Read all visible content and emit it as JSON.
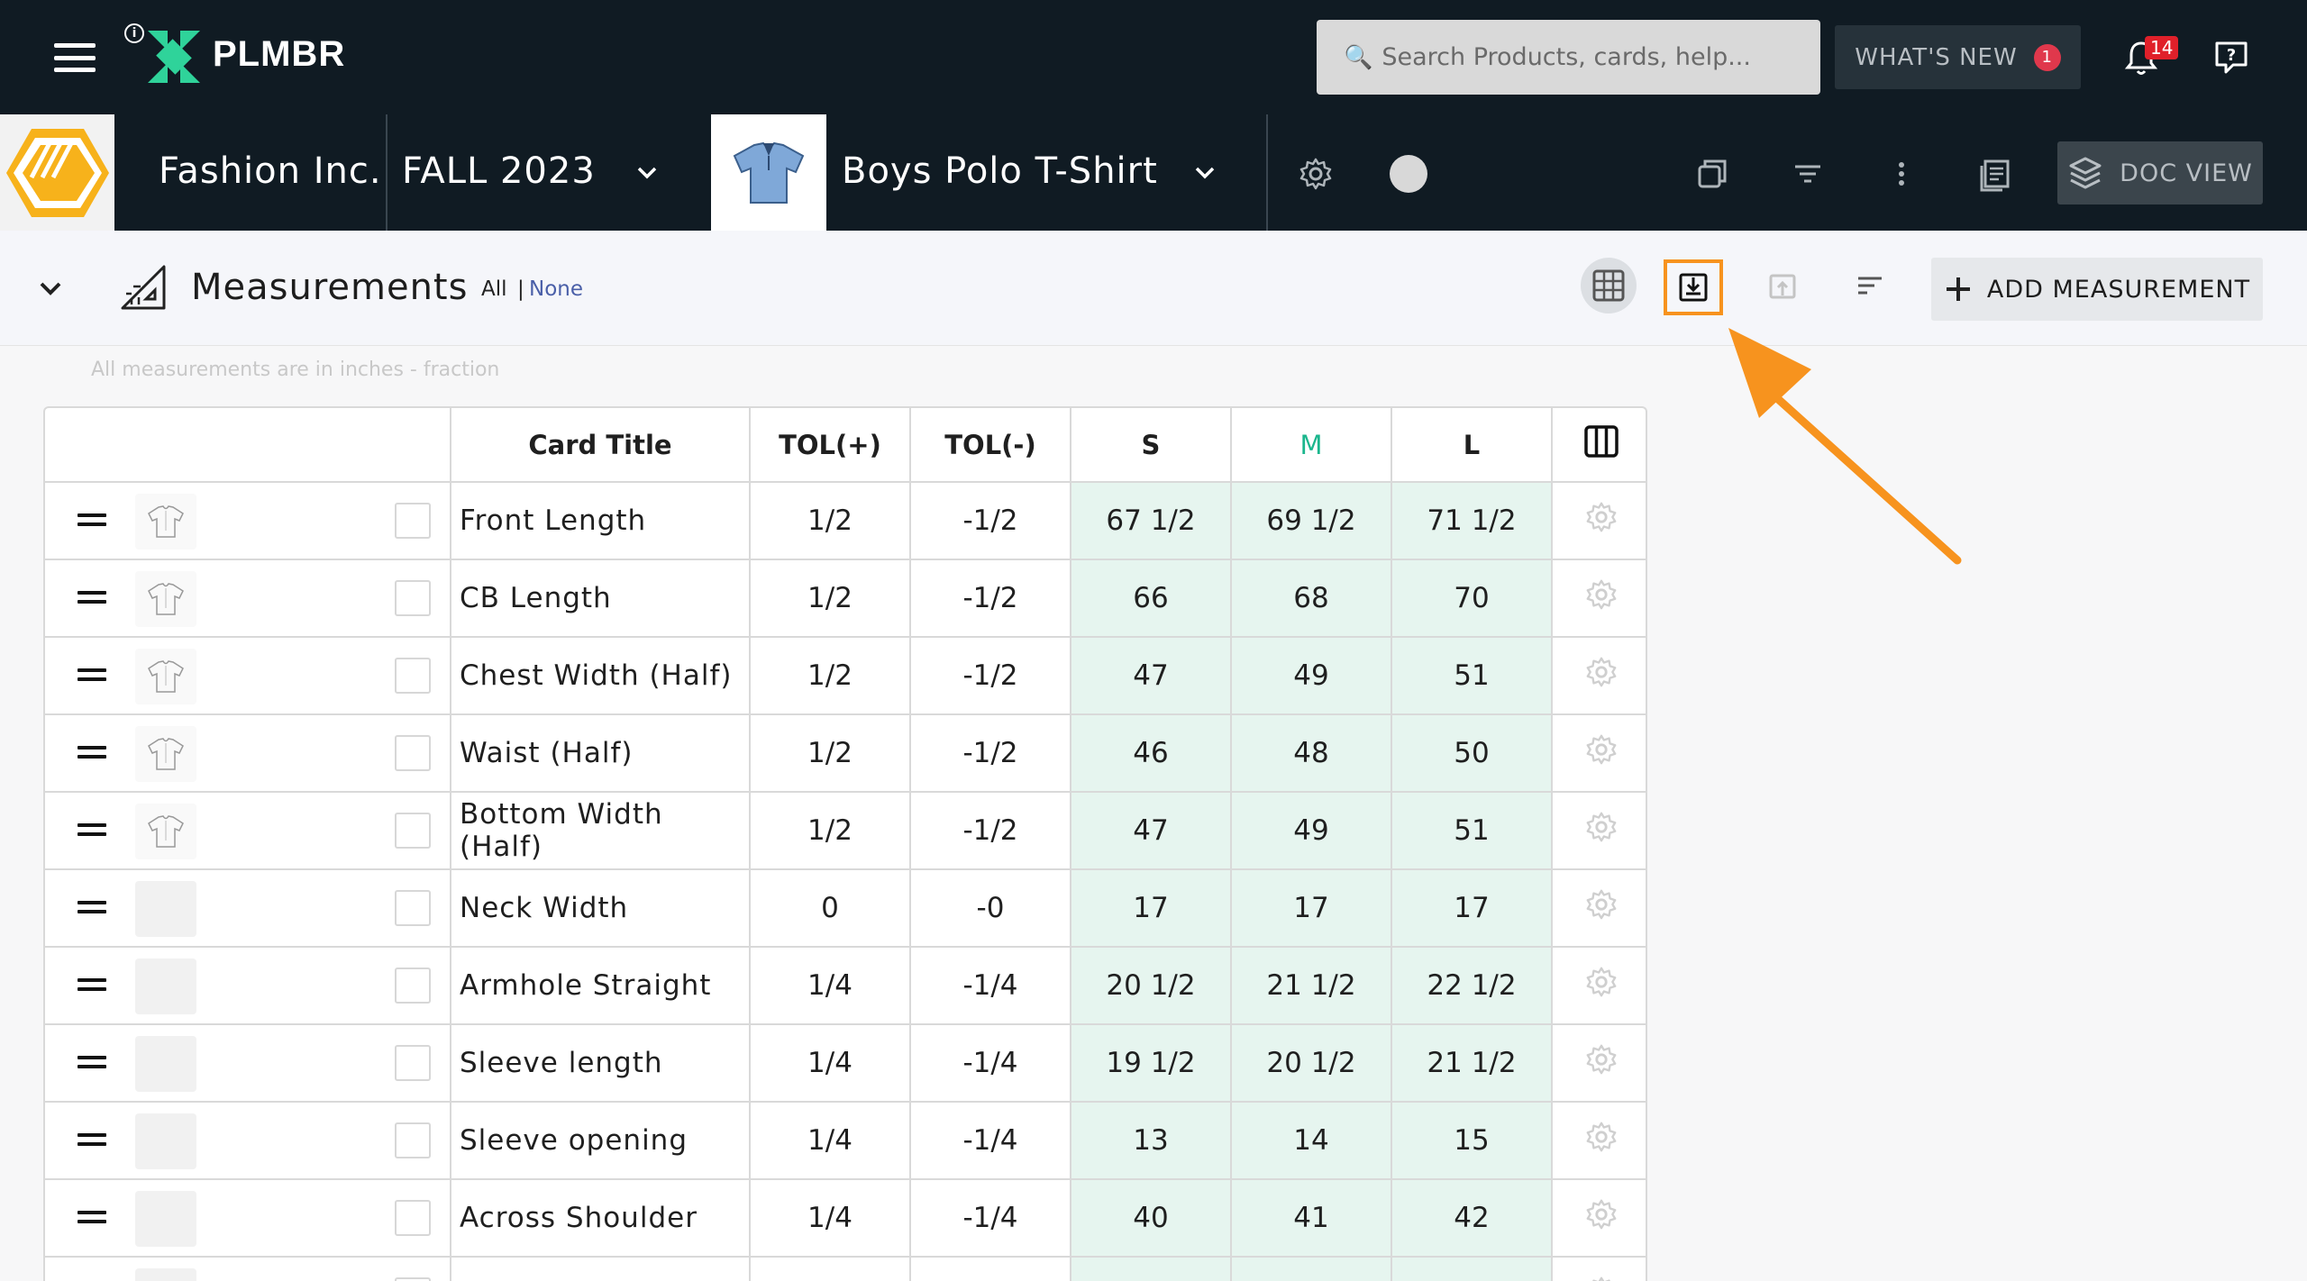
{
  "topbar": {
    "logo_text": "PLMBR",
    "search_placeholder": "Search Products, cards, help...",
    "whats_new_label": "WHAT'S NEW",
    "whats_new_count": "1",
    "notification_count": "14"
  },
  "context": {
    "company": "Fashion Inc.",
    "season": "FALL 2023",
    "product": "Boys Polo T-Shirt",
    "doc_view_label": "DOC VIEW"
  },
  "section": {
    "title": "Measurements",
    "filter_all": "All",
    "filter_sep": "|",
    "filter_none": "None",
    "add_label": "ADD MEASUREMENT",
    "note": "All measurements are in inches - fraction"
  },
  "table": {
    "headers": {
      "card_title": "Card Title",
      "tol_plus": "TOL(+)",
      "tol_minus": "TOL(-)",
      "s": "S",
      "m": "M",
      "l": "L"
    },
    "rows": [
      {
        "name": "Front Length",
        "tol_plus": "1/2",
        "tol_minus": "-1/2",
        "s": "67 1/2",
        "m": "69 1/2",
        "l": "71 1/2",
        "has_image": true
      },
      {
        "name": "CB Length",
        "tol_plus": "1/2",
        "tol_minus": "-1/2",
        "s": "66",
        "m": "68",
        "l": "70",
        "has_image": true
      },
      {
        "name": "Chest Width (Half)",
        "tol_plus": "1/2",
        "tol_minus": "-1/2",
        "s": "47",
        "m": "49",
        "l": "51",
        "has_image": true
      },
      {
        "name": "Waist (Half)",
        "tol_plus": "1/2",
        "tol_minus": "-1/2",
        "s": "46",
        "m": "48",
        "l": "50",
        "has_image": true
      },
      {
        "name": "Bottom Width (Half)",
        "tol_plus": "1/2",
        "tol_minus": "-1/2",
        "s": "47",
        "m": "49",
        "l": "51",
        "has_image": true
      },
      {
        "name": "Neck Width",
        "tol_plus": "0",
        "tol_minus": "-0",
        "s": "17",
        "m": "17",
        "l": "17",
        "has_image": false
      },
      {
        "name": "Armhole Straight",
        "tol_plus": "1/4",
        "tol_minus": "-1/4",
        "s": "20 1/2",
        "m": "21 1/2",
        "l": "22 1/2",
        "has_image": false
      },
      {
        "name": "Sleeve length",
        "tol_plus": "1/4",
        "tol_minus": "-1/4",
        "s": "19 1/2",
        "m": "20 1/2",
        "l": "21 1/2",
        "has_image": false
      },
      {
        "name": "Sleeve opening",
        "tol_plus": "1/4",
        "tol_minus": "-1/4",
        "s": "13",
        "m": "14",
        "l": "15",
        "has_image": false
      },
      {
        "name": "Across Shoulder",
        "tol_plus": "1/4",
        "tol_minus": "-1/4",
        "s": "40",
        "m": "41",
        "l": "42",
        "has_image": false
      },
      {
        "name": "",
        "tol_plus": "",
        "tol_minus": "",
        "s": "",
        "m": "",
        "l": "",
        "has_image": false
      }
    ]
  },
  "colors": {
    "topbar_bg": "#101b23",
    "accent_orange": "#f7931e",
    "size_cell_bg": "#e6f5ef",
    "m_header": "#1bb68d",
    "badge_red": "#e0384c"
  },
  "icons": [
    "menu-icon",
    "info-icon",
    "search-icon",
    "bell-icon",
    "help-chat-icon",
    "chevron-down-icon",
    "settings-gear-icon",
    "copy-icon",
    "filter-icon",
    "more-vertical-icon",
    "document-list-icon",
    "layers-icon",
    "ruler-triangle-icon",
    "grid-icon",
    "export-download-icon",
    "import-icon",
    "sort-icon",
    "plus-icon",
    "columns-icon",
    "drag-handle-icon"
  ]
}
